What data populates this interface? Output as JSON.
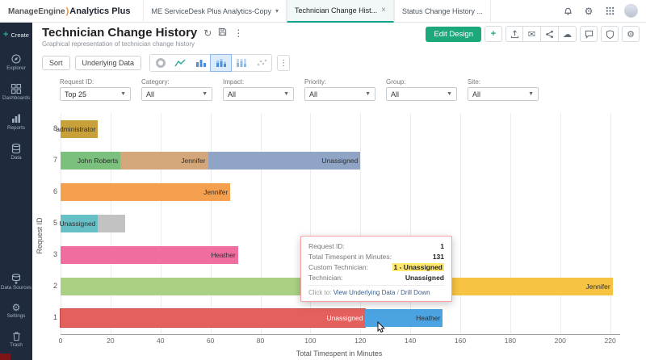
{
  "topbar": {
    "brand": "ManageEngine",
    "brkt": ")",
    "product": "Analytics Plus",
    "tabs": [
      {
        "label": "ME ServiceDesk Plus Analytics-Copy"
      },
      {
        "label": "Technician Change Hist..."
      },
      {
        "label": "Status Change History ..."
      }
    ]
  },
  "sidebar": {
    "create_label": "Create",
    "items": [
      {
        "label": "Explorer"
      },
      {
        "label": "Dashboards"
      },
      {
        "label": "Reports"
      },
      {
        "label": "Data"
      },
      {
        "label": "Data Sources"
      },
      {
        "label": "Settings"
      },
      {
        "label": "Trash"
      }
    ]
  },
  "header": {
    "title": "Technician Change History",
    "subtitle": "Graphical representation of technician change history",
    "edit_design_label": "Edit Design"
  },
  "toolbar": {
    "sort_label": "Sort",
    "underlying_label": "Underlying Data"
  },
  "filters": [
    {
      "label": "Request ID:",
      "value": "Top 25"
    },
    {
      "label": "Category:",
      "value": "All"
    },
    {
      "label": "Impact:",
      "value": "All"
    },
    {
      "label": "Priority:",
      "value": "All"
    },
    {
      "label": "Group:",
      "value": "All"
    },
    {
      "label": "Site:",
      "value": "All"
    }
  ],
  "tooltip": {
    "rows": [
      {
        "label": "Request ID:",
        "value": "1"
      },
      {
        "label": "Total Timespent in Minutes:",
        "value": "131"
      },
      {
        "label": "Custom Technician:",
        "value": "1 - Unassigned"
      },
      {
        "label": "Technician:",
        "value": "Unassigned"
      }
    ],
    "footer_prefix": "Click to:",
    "footer_link1": "View Underlying Data",
    "footer_sep": " / ",
    "footer_link2": "Drill Down"
  },
  "chart_data": {
    "type": "bar",
    "orientation": "horizontal",
    "stacked": true,
    "xlabel": "Total Timespent in Minutes",
    "ylabel": "Request ID",
    "xmax": 224,
    "xticks": [
      0,
      20,
      40,
      60,
      80,
      100,
      120,
      140,
      160,
      180,
      200,
      220
    ],
    "categories": [
      "8",
      "7",
      "6",
      "5",
      "3",
      "2",
      "1"
    ],
    "rows": [
      {
        "category": "8",
        "segments": [
          {
            "label": "administrator",
            "value": 15,
            "color": "#c9a13b"
          }
        ]
      },
      {
        "category": "7",
        "segments": [
          {
            "label": "John Roberts",
            "value": 24,
            "color": "#7cc07d"
          },
          {
            "label": "Jennifer",
            "value": 35,
            "color": "#d4a77a"
          },
          {
            "label": "Unassigned",
            "value": 61,
            "color": "#90a5c5"
          }
        ]
      },
      {
        "category": "6",
        "segments": [
          {
            "label": "Jennifer",
            "value": 68,
            "color": "#f5a04e"
          }
        ]
      },
      {
        "category": "5",
        "segments": [
          {
            "label": "Unassigned",
            "value": 15,
            "color": "#67c0c6"
          },
          {
            "label": "",
            "value": 11,
            "color": "#c2c2c2"
          }
        ]
      },
      {
        "category": "3",
        "segments": [
          {
            "label": "Heather",
            "value": 71,
            "color": "#f06da0"
          }
        ]
      },
      {
        "category": "2",
        "segments": [
          {
            "label": "",
            "value": 120,
            "color": "#a9d083"
          },
          {
            "label": "Jennifer",
            "value": 101,
            "color": "#f7c342"
          }
        ]
      },
      {
        "category": "1",
        "segments": [
          {
            "label": "Unassigned",
            "value": 122,
            "color": "#e4605c",
            "hatch": true,
            "text": "#ffffff"
          },
          {
            "label": "Heather",
            "value": 31,
            "color": "#4ba3e2"
          }
        ]
      }
    ]
  }
}
